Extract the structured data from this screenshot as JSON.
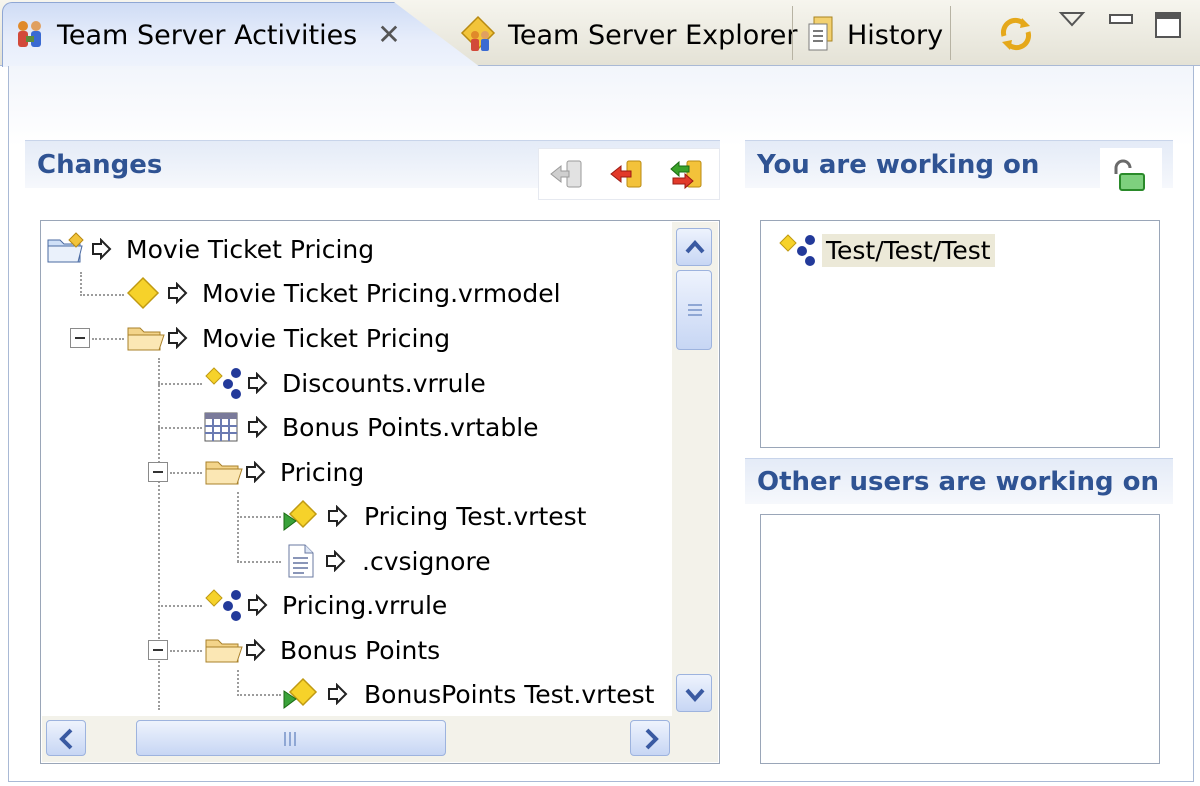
{
  "tabs": [
    {
      "label": "Team Server Activities",
      "active": true,
      "icon": "team-activities-icon"
    },
    {
      "label": "Team Server Explorer",
      "active": false,
      "icon": "team-explorer-icon"
    },
    {
      "label": "History",
      "active": false,
      "icon": "history-icon"
    }
  ],
  "tab_toolbar": [
    "sync-icon",
    "view-menu-icon",
    "minimize-icon",
    "maximize-icon"
  ],
  "changes": {
    "title": "Changes",
    "toolbar": [
      "commit-in-icon",
      "commit-out-icon",
      "sync-changes-icon"
    ],
    "tree": [
      {
        "label": "Movie Ticket Pricing",
        "icon": "project-folder-icon"
      },
      {
        "label": "Movie Ticket Pricing.vrmodel",
        "icon": "vrmodel-icon"
      },
      {
        "label": "Movie Ticket Pricing",
        "icon": "folder-open-icon"
      },
      {
        "label": "Discounts.vrrule",
        "icon": "vrrule-icon"
      },
      {
        "label": "Bonus Points.vrtable",
        "icon": "vrtable-icon"
      },
      {
        "label": "Pricing",
        "icon": "folder-open-icon"
      },
      {
        "label": "Pricing Test.vrtest",
        "icon": "vrtest-icon"
      },
      {
        "label": ".cvsignore",
        "icon": "text-file-icon"
      },
      {
        "label": "Pricing.vrrule",
        "icon": "vrrule-icon"
      },
      {
        "label": "Bonus Points",
        "icon": "folder-open-icon"
      },
      {
        "label": "BonusPoints Test.vrtest",
        "icon": "vrtest-icon"
      }
    ]
  },
  "working_on": {
    "title": "You are working on",
    "items": [
      {
        "label": "Test/Test/Test",
        "icon": "vrrule-icon"
      }
    ]
  },
  "others": {
    "title": "Other users are working on",
    "items": []
  },
  "colors": {
    "header_text": "#2f5393",
    "tab_active": "#dfe7f8",
    "selection": "#ece9d8"
  }
}
